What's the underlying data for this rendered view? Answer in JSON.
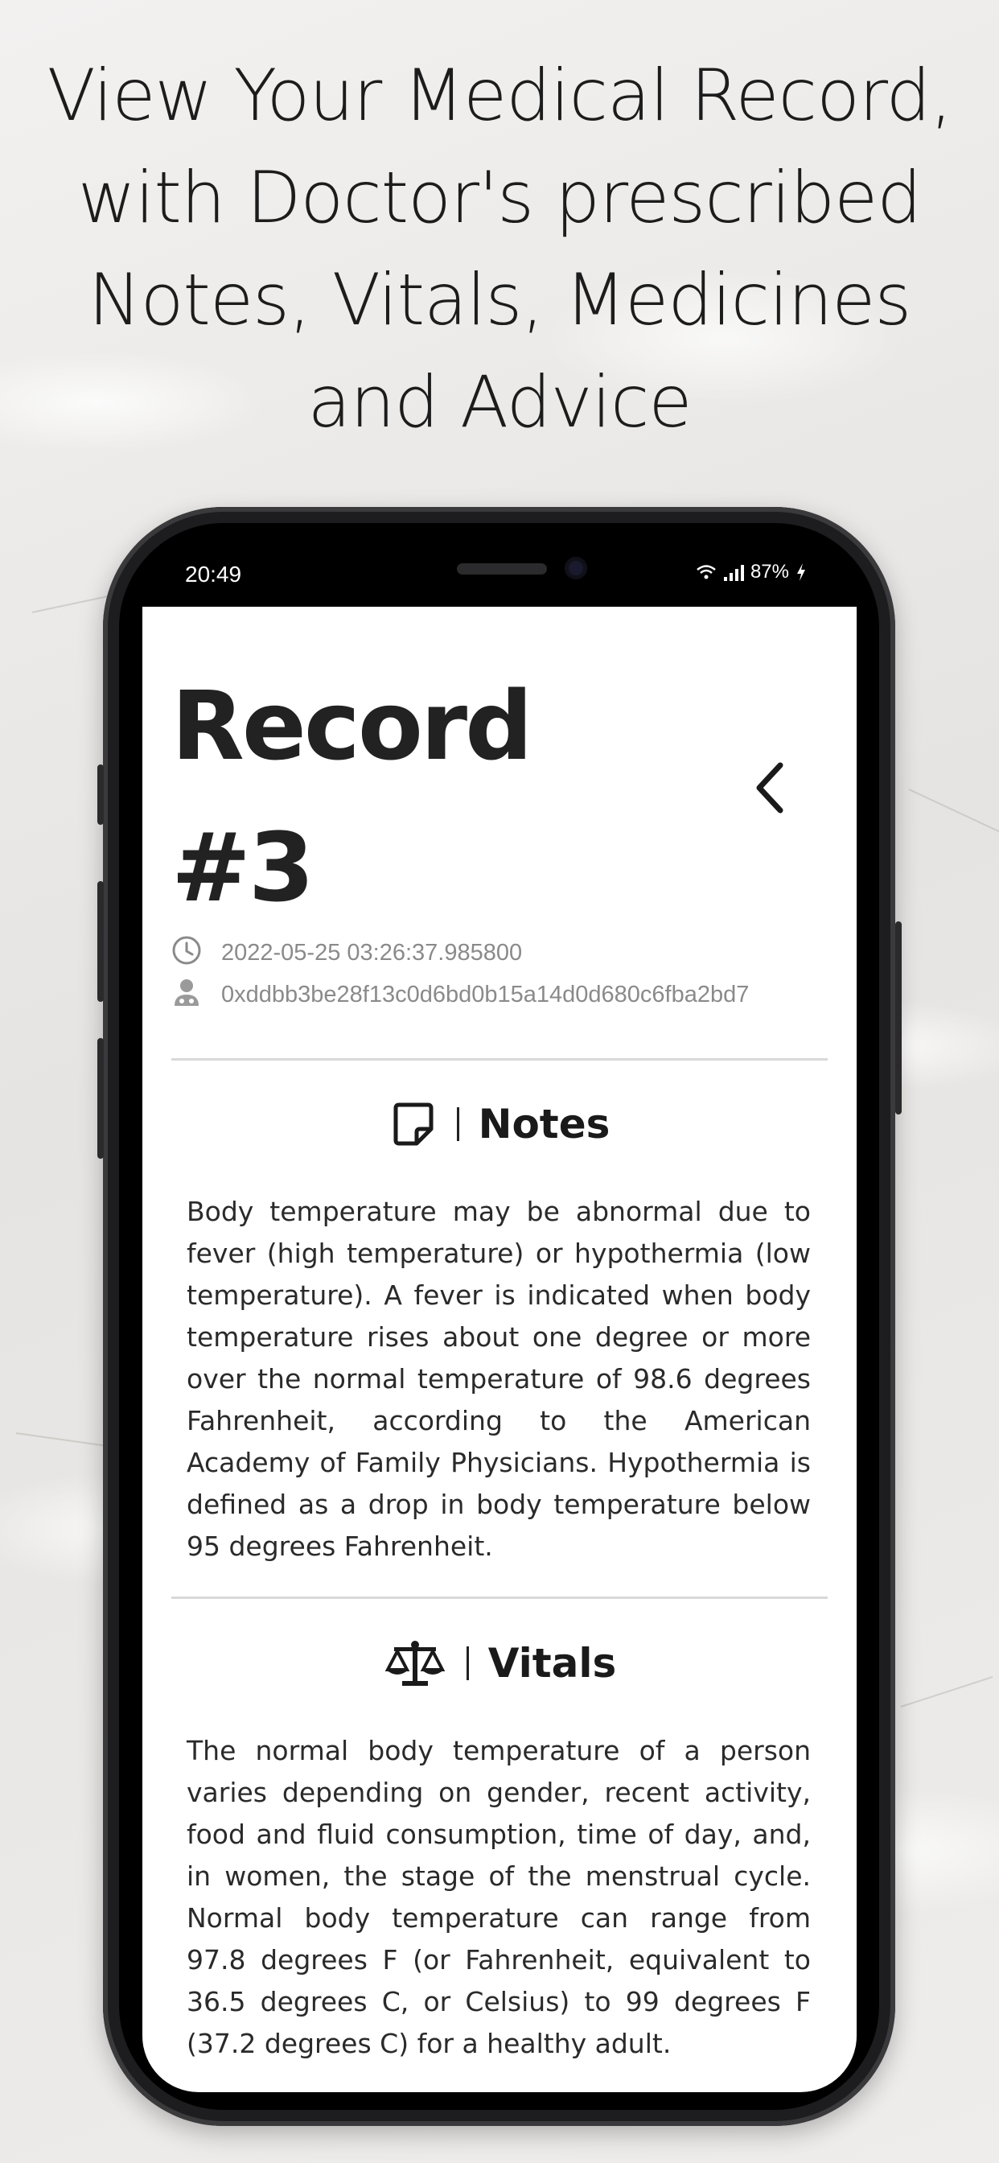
{
  "headline": "View Your Medical Record, with Doctor's prescribed Notes, Vitals, Medicines and Advice",
  "status_bar": {
    "time": "20:49",
    "battery": "87%"
  },
  "record": {
    "title": "Record #3",
    "timestamp": "2022-05-25 03:26:37.985800",
    "doctor_id": "0xddbb3be28f13c0d6bd0b15a14d0d680c6fba2bd7"
  },
  "sections": {
    "notes": {
      "title": "Notes",
      "icon": "sticky-note-icon",
      "body": "Body temperature may be abnormal due to fever (high temperature) or hypothermia (low temperature). A fever is indicated when body temperature rises about one degree or more over the normal temperature of 98.6 degrees Fahrenheit, according to the American Academy of Family Physicians. Hypothermia is defined as a drop in body temperature below 95 degrees Fahrenheit."
    },
    "vitals": {
      "title": "Vitals",
      "icon": "scale-icon",
      "body": "The normal body temperature of a person varies depending on gender, recent activity, food and fluid consumption, time of day, and, in women, the stage of the menstrual cycle. Normal body temperature can range from 97.8 degrees F (or Fahrenheit, equivalent to 36.5 degrees C, or Celsius) to 99 degrees F (37.2 degrees C) for a healthy adult."
    }
  },
  "colors": {
    "text": "#222222",
    "muted": "#8a8a8a",
    "divider": "#d9d9d9",
    "screen_bg": "#ffffff"
  },
  "icons": [
    "clock-icon",
    "doctor-icon",
    "back-chevron-icon",
    "sticky-note-icon",
    "scale-icon"
  ]
}
